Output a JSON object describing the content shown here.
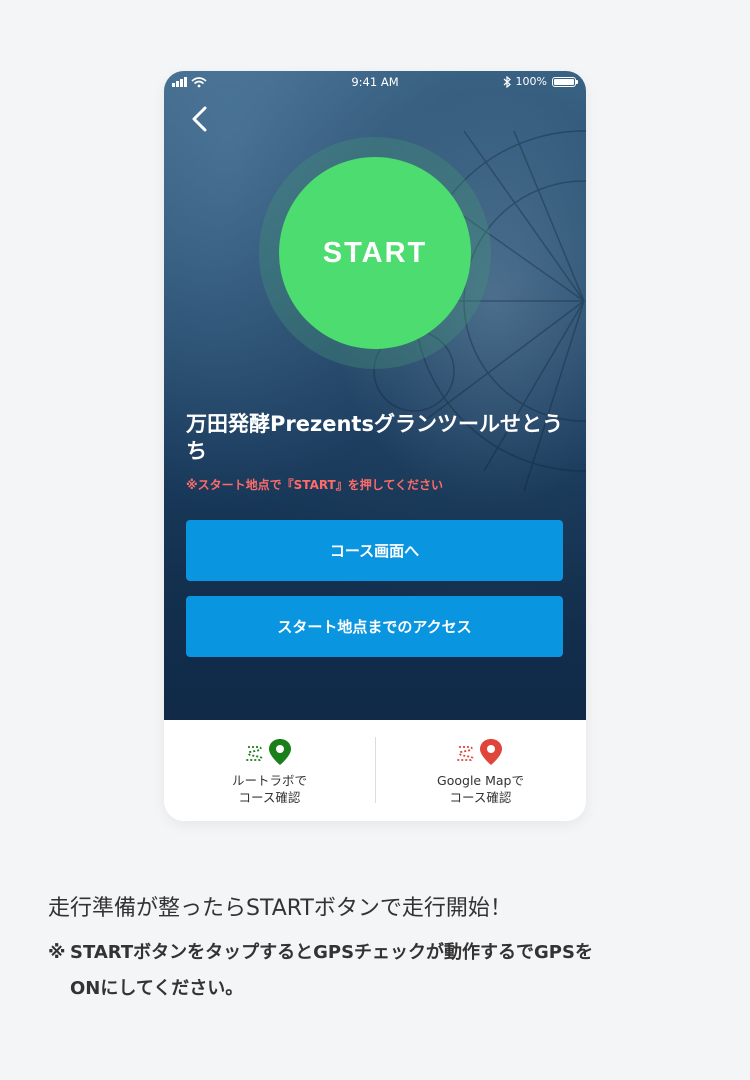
{
  "status_bar": {
    "time": "9:41 AM",
    "battery": "100%"
  },
  "start_button": {
    "label": "START"
  },
  "event": {
    "title": "万田発酵Prezentsグランツールせとうち",
    "note": "※スタート地点で『START』を押してください"
  },
  "actions": {
    "course_label": "コース画面へ",
    "access_label": "スタート地点までのアクセス"
  },
  "tabs": [
    {
      "line1": "ルートラボで",
      "line2": "コース確認",
      "icon": "route-pin-green-icon",
      "color": "#1a7f1a"
    },
    {
      "line1": "Google Mapで",
      "line2": "コース確認",
      "icon": "route-pin-red-icon",
      "color": "#e0453a"
    }
  ],
  "caption": {
    "title": "走行準備が整ったらSTARTボタンで走行開始！",
    "note_mark": "※",
    "note_line1": "STARTボタンをタップするとGPSチェックが動作するでGPSを",
    "note_line2": "ONにしてください。"
  },
  "colors": {
    "start_green": "#4cdc6f",
    "button_blue": "#0a95e0",
    "note_red": "#ff6b6b"
  }
}
